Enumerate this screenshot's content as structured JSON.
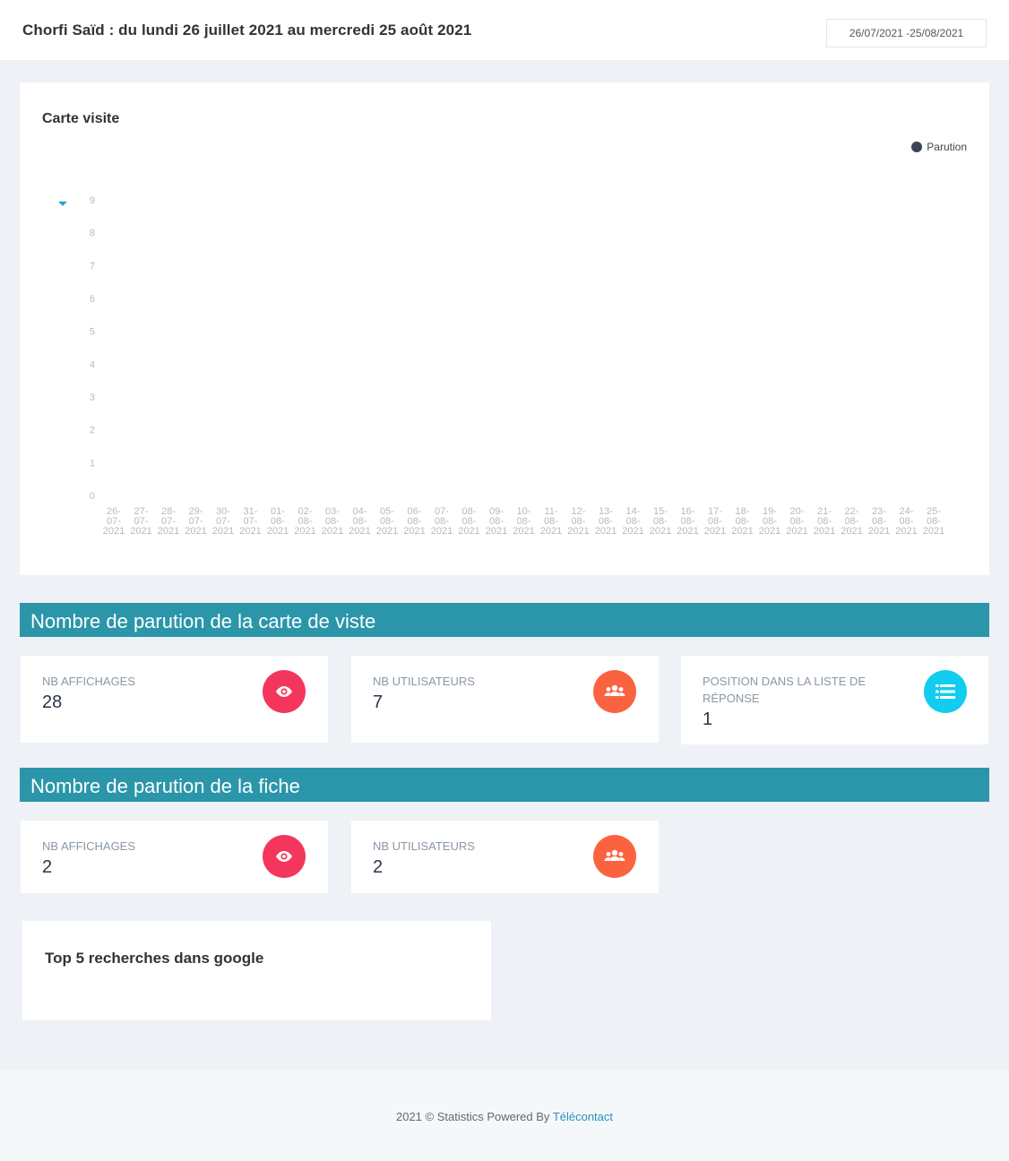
{
  "header": {
    "title": "Chorfi Saïd : du lundi 26 juillet 2021 au mercredi 25 août 2021",
    "date_range": "26/07/2021  -25/08/2021"
  },
  "chart_card": {
    "title": "Carte visite"
  },
  "chart_data": {
    "type": "line",
    "title": "Carte visite",
    "series": [
      {
        "name": "Parution",
        "values": []
      }
    ],
    "y_ticks": [
      "9",
      "8",
      "7",
      "6",
      "5",
      "4",
      "3",
      "2",
      "1",
      "0"
    ],
    "ylim": [
      0,
      9
    ],
    "x": [
      [
        "26-",
        "07-",
        "2021"
      ],
      [
        "27-",
        "07-",
        "2021"
      ],
      [
        "28-",
        "07-",
        "2021"
      ],
      [
        "29-",
        "07-",
        "2021"
      ],
      [
        "30-",
        "07-",
        "2021"
      ],
      [
        "31-",
        "07-",
        "2021"
      ],
      [
        "01-",
        "08-",
        "2021"
      ],
      [
        "02-",
        "08-",
        "2021"
      ],
      [
        "03-",
        "08-",
        "2021"
      ],
      [
        "04-",
        "08-",
        "2021"
      ],
      [
        "05-",
        "08-",
        "2021"
      ],
      [
        "06-",
        "08-",
        "2021"
      ],
      [
        "07-",
        "08-",
        "2021"
      ],
      [
        "08-",
        "08-",
        "2021"
      ],
      [
        "09-",
        "08-",
        "2021"
      ],
      [
        "10-",
        "08-",
        "2021"
      ],
      [
        "11-",
        "08-",
        "2021"
      ],
      [
        "12-",
        "08-",
        "2021"
      ],
      [
        "13-",
        "08-",
        "2021"
      ],
      [
        "14-",
        "08-",
        "2021"
      ],
      [
        "15-",
        "08-",
        "2021"
      ],
      [
        "16-",
        "08-",
        "2021"
      ],
      [
        "17-",
        "08-",
        "2021"
      ],
      [
        "18-",
        "08-",
        "2021"
      ],
      [
        "19-",
        "08-",
        "2021"
      ],
      [
        "20-",
        "08-",
        "2021"
      ],
      [
        "21-",
        "08-",
        "2021"
      ],
      [
        "22-",
        "08-",
        "2021"
      ],
      [
        "23-",
        "08-",
        "2021"
      ],
      [
        "24-",
        "08-",
        "2021"
      ],
      [
        "25-",
        "08-",
        "2021"
      ]
    ],
    "legend_position": "top-right",
    "grid": false,
    "accent_color": "#3d4457",
    "tick_color": "#b9b9b9",
    "marker_color": "#2a9fd6"
  },
  "section1": {
    "title": "Nombre de parution de la carte de viste",
    "cards": [
      {
        "label": "NB AFFICHAGES",
        "value": "28",
        "icon": "eye-icon",
        "color": "#f5365c"
      },
      {
        "label": "NB UTILISATEURS",
        "value": "7",
        "icon": "users-icon",
        "color": "#fb6340"
      },
      {
        "label": "POSITION DANS LA LISTE DE RÉPONSE",
        "value": "1",
        "icon": "list-icon",
        "color": "#11cdef"
      }
    ]
  },
  "section2": {
    "title": "Nombre de parution de la fiche",
    "cards": [
      {
        "label": "NB AFFICHAGES",
        "value": "2",
        "icon": "eye-icon",
        "color": "#f5365c"
      },
      {
        "label": "NB UTILISATEURS",
        "value": "2",
        "icon": "users-icon",
        "color": "#fb6340"
      }
    ]
  },
  "top5": {
    "title": "Top 5 recherches dans google"
  },
  "footer": {
    "text": "2021 © Statistics Powered By ",
    "link": "Télécontact"
  }
}
